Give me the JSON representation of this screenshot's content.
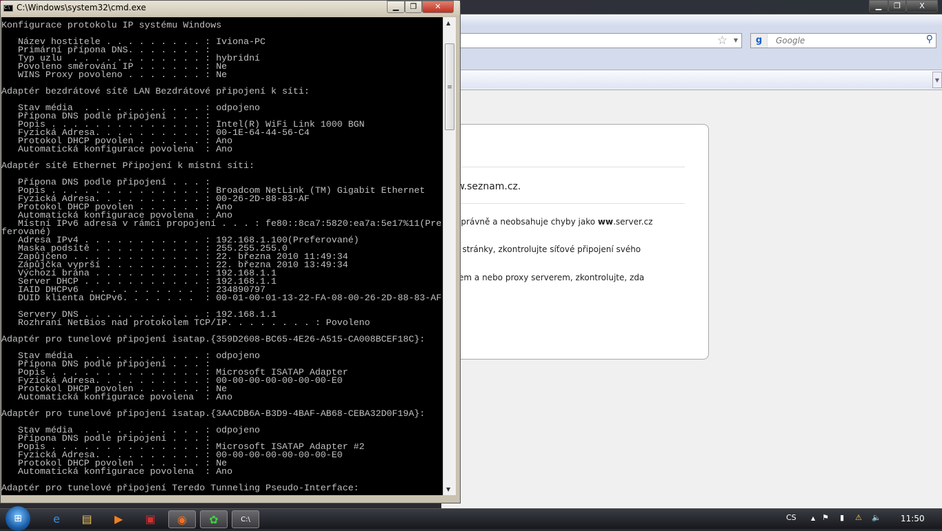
{
  "cmd": {
    "title": "C:\\Windows\\system32\\cmd.exe",
    "minimize": "▁",
    "maximize": "❐",
    "close": "✕",
    "lines": [
      "Konfigurace protokolu IP systému Windows",
      "",
      "   Název hostitele . . . . . . . . . : Iviona-PC",
      "   Primární přípona DNS. . . . . . . :",
      "   Typ uzlu  . . . . . . . . . . . . : hybridní",
      "   Povoleno směrování IP . . . . . . : Ne",
      "   WINS Proxy povoleno . . . . . . . : Ne",
      "",
      "Adaptér bezdrátové sítě LAN Bezdrátové připojení k síti:",
      "",
      "   Stav média  . . . . . . . . . . . : odpojeno",
      "   Přípona DNS podle připojení . . . :",
      "   Popis . . . . . . . . . . . . . . : Intel(R) WiFi Link 1000 BGN",
      "   Fyzická Adresa. . . . . . . . . . : 00-1E-64-44-56-C4",
      "   Protokol DHCP povolen . . . . . . : Ano",
      "   Automatická konfigurace povolena  : Ano",
      "",
      "Adaptér sítě Ethernet Připojení k místní síti:",
      "",
      "   Přípona DNS podle připojení . . . :",
      "   Popis . . . . . . . . . . . . . . : Broadcom NetLink (TM) Gigabit Ethernet",
      "   Fyzická Adresa. . . . . . . . . . : 00-26-2D-88-83-AF",
      "   Protokol DHCP povolen . . . . . . : Ano",
      "   Automatická konfigurace povolena  : Ano",
      "   Místní IPv6 adresa v rámci propojení . . . : fe80::8ca7:5820:ea7a:5e17%11(Pre",
      "ferované)",
      "   Adresa IPv4 . . . . . . . . . . . : 192.168.1.100(Preferované)",
      "   Maska podsítě . . . . . . . . . . : 255.255.255.0",
      "   Zapůjčeno . . . . . . . . . . . . : 22. března 2010 11:49:34",
      "   Zápůjčka vyprší . . . . . . . . . : 22. března 2010 13:49:34",
      "   Výchozí brána . . . . . . . . . . : 192.168.1.1",
      "   Server DHCP . . . . . . . . . . . : 192.168.1.1",
      "   IAID DHCPv6  . . . . . . . . . .  : 234890797",
      "   DUID klienta DHCPv6. . . . . . .  : 00-01-00-01-13-22-FA-08-00-26-2D-88-83-AF",
      "",
      "   Servery DNS . . . . . . . . . . . : 192.168.1.1",
      "   Rozhraní NetBios nad protokolem TCP/IP. . . . . . . . : Povoleno",
      "",
      "Adaptér pro tunelové připojení isatap.{359D2608-BC65-4E26-A515-CA008BCEF18C}:",
      "",
      "   Stav média  . . . . . . . . . . . : odpojeno",
      "   Přípona DNS podle připojení . . . :",
      "   Popis . . . . . . . . . . . . . . : Microsoft ISATAP Adapter",
      "   Fyzická Adresa. . . . . . . . . . : 00-00-00-00-00-00-00-E0",
      "   Protokol DHCP povolen . . . . . . : Ne",
      "   Automatická konfigurace povolena  : Ano",
      "",
      "Adaptér pro tunelové připojení isatap.{3AACDB6A-B3D9-4BAF-AB68-CEBA32D0F19A}:",
      "",
      "   Stav média  . . . . . . . . . . . : odpojeno",
      "   Přípona DNS podle připojení . . . :",
      "   Popis . . . . . . . . . . . . . . : Microsoft ISATAP Adapter #2",
      "   Fyzická Adresa. . . . . . . . . . : 00-00-00-00-00-00-00-E0",
      "   Protokol DHCP povolen . . . . . . : Ne",
      "   Automatická konfigurace povolena  : Ano",
      "",
      "Adaptér pro tunelové připojení Teredo Tunneling Pseudo-Interface:"
    ]
  },
  "browser": {
    "minimize": "▁",
    "maximize": "❐",
    "close": "X",
    "search_placeholder": "Google",
    "search_engine_logo": "g",
    "error": {
      "line1": "ww.seznam.cz.",
      "line2a": "a správně a neobsahuje chyby jako ",
      "line2b": "ww",
      "line2c": ".server.cz",
      "line3": "tní stránky, zkontrolujte síťové připojení svého",
      "line4": "allem a nebo proxy serverem, zkontrolujte, zda"
    }
  },
  "taskbar": {
    "items": [
      "internet-explorer",
      "explorer",
      "media-player",
      "app",
      "firefox",
      "icq",
      "cmd"
    ],
    "language": "CS",
    "clock": "11:50"
  }
}
